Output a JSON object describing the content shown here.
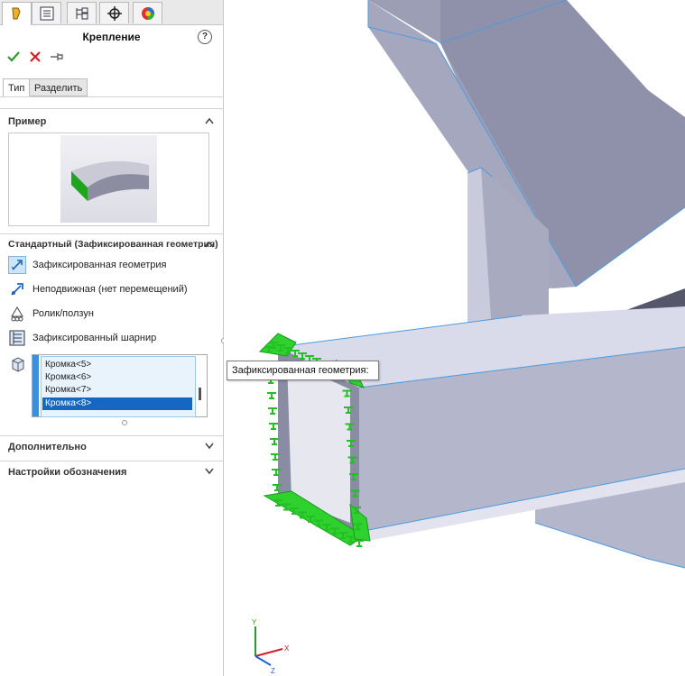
{
  "panel": {
    "top_tabs": [
      {
        "icon": "featuremanager-icon",
        "active": true
      },
      {
        "icon": "propertymanager-icon",
        "active": false
      },
      {
        "icon": "configurationmanager-icon",
        "active": false
      },
      {
        "icon": "dimxpert-icon",
        "active": false
      },
      {
        "icon": "display-manager-icon",
        "active": false
      }
    ],
    "title": "Крепление",
    "help_label": "?",
    "actions": {
      "ok_icon": "checkmark-icon",
      "cancel_icon": "x-icon",
      "pin_icon": "pushpin-icon"
    },
    "sub_tabs": [
      "Тип",
      "Разделить"
    ],
    "example_section": {
      "title": "Пример"
    },
    "standard_section": {
      "title": "Стандартный (Зафиксированная геометрия)",
      "options": [
        {
          "label": "Зафиксированная геометрия",
          "icon": "fixed-geometry-icon",
          "selected": true
        },
        {
          "label": "Неподвижная (нет перемещений)",
          "icon": "immovable-icon",
          "selected": false
        },
        {
          "label": "Ролик/ползун",
          "icon": "roller-slider-icon",
          "selected": false
        },
        {
          "label": "Зафиксированный шарнир",
          "icon": "fixed-hinge-icon",
          "selected": false
        }
      ],
      "selection_list": [
        "Кромка<5>",
        "Кромка<6>",
        "Кромка<7>",
        "Кромка<8>"
      ],
      "selected_item": "Кромка<8>"
    },
    "advanced_section": {
      "title": "Дополнительно"
    },
    "symbol_section": {
      "title": "Настройки обозначения"
    }
  },
  "viewport": {
    "tooltip": "Зафиксированная геометрия:",
    "triad": {
      "x": "X",
      "y": "Y",
      "z": "Z"
    }
  },
  "colors": {
    "accent": "#1767c1",
    "fixture_green": "#2fd12f",
    "part_face": "#a9aac0",
    "part_edge": "#4b9be0"
  }
}
